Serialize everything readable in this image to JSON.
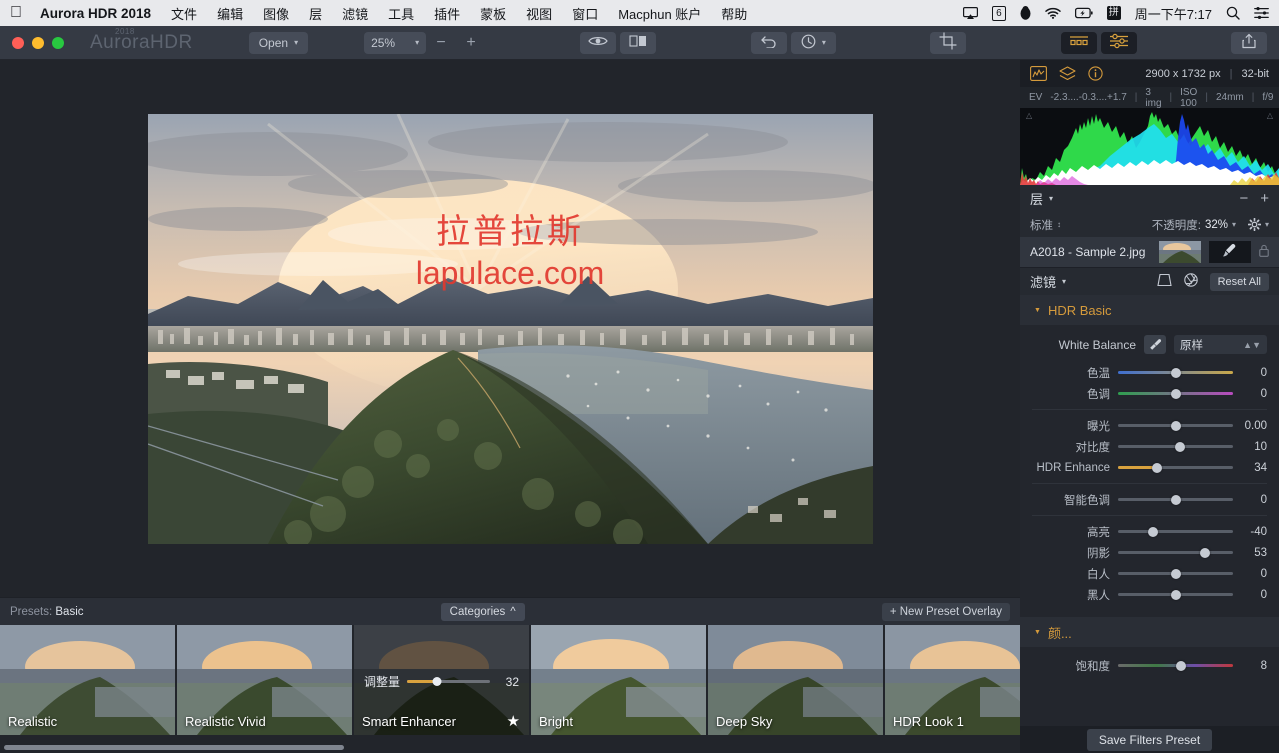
{
  "menubar": {
    "apple": "apple-logo",
    "app_name": "Aurora HDR 2018",
    "items": [
      "文件",
      "编辑",
      "图像",
      "层",
      "滤镜",
      "工具",
      "插件",
      "蒙板",
      "视图",
      "窗口",
      "Macphun 账户",
      "帮助"
    ],
    "status": {
      "airplay": "airplay-icon",
      "badge_count": "6",
      "qq": "qq-icon",
      "wifi": "wifi-icon",
      "battery": "battery-charging-icon",
      "input_method": "拼",
      "clock": "周一下午7:17",
      "search": "search-icon",
      "control_center": "list-icon"
    }
  },
  "toolbar": {
    "logo_text": "AuroraHDR",
    "logo_year": "2018",
    "open_label": "Open",
    "zoom_level": "25%",
    "zoom_out": "−",
    "zoom_in": "+",
    "preview_icon": "eye-icon",
    "compare_icon": "split-compare-icon",
    "undo_icon": "undo-arrow-icon",
    "history_icon": "history-clock-icon",
    "crop_icon": "crop-icon",
    "presets_icon": "presets-grid-icon",
    "filters_icon": "sliders-icon",
    "share_icon": "share-upload-icon"
  },
  "canvas": {
    "watermark_cn": "拉普拉斯",
    "watermark_url": "lapulace.com"
  },
  "presets_bar": {
    "label_prefix": "Presets:",
    "current_category": "Basic",
    "categories_button": "Categories",
    "categories_caret": "^",
    "new_overlay_button": "+ New Preset Overlay"
  },
  "presets": [
    {
      "name": "Realistic",
      "selected": false
    },
    {
      "name": "Realistic Vivid",
      "selected": false
    },
    {
      "name": "Smart Enhancer",
      "selected": true,
      "amount_label": "调整量",
      "amount_value": "32",
      "favorite_icon": "star-icon"
    },
    {
      "name": "Bright",
      "selected": false
    },
    {
      "name": "Deep Sky",
      "selected": false
    },
    {
      "name": "HDR Look 1",
      "selected": false
    }
  ],
  "right_panel": {
    "info": {
      "histogram_icon": "histogram-icon",
      "layers_icon": "layers-icon",
      "info_icon": "info-circle-icon",
      "dimensions": "2900 x 1732 px",
      "bit_depth": "32-bit"
    },
    "exif": {
      "ev_label": "EV",
      "ev_values": "-2.3....-0.3....+1.7",
      "images": "3 img",
      "iso": "ISO 100",
      "focal": "24mm",
      "aperture": "f/9"
    },
    "layers": {
      "title": "层",
      "remove": "−",
      "add": "+",
      "blend_mode": "标准",
      "opacity_label": "不透明度:",
      "opacity_value": "32%",
      "gear_icon": "gear-icon",
      "layer_name": "A2018 - Sample 2.jpg",
      "mask_icon": "brush-mask-icon",
      "lock_icon": "lock-icon"
    },
    "filters": {
      "title": "滤镜",
      "transform_icon": "transform-icon",
      "aperture_icon": "aperture-icon",
      "reset_all": "Reset All",
      "sections": [
        {
          "title": "HDR Basic",
          "white_balance": {
            "label": "White Balance",
            "eyedropper_icon": "eyedropper-icon",
            "value": "原样"
          },
          "groups": [
            {
              "sliders": [
                {
                  "label": "色温",
                  "value": "0",
                  "pos": 50,
                  "type": "temp"
                },
                {
                  "label": "色调",
                  "value": "0",
                  "pos": 50,
                  "type": "tint"
                }
              ]
            },
            {
              "sliders": [
                {
                  "label": "曝光",
                  "value": "0.00",
                  "pos": 50,
                  "type": "plain"
                },
                {
                  "label": "对比度",
                  "value": "10",
                  "pos": 54,
                  "type": "fill"
                },
                {
                  "label": "HDR Enhance",
                  "value": "34",
                  "pos": 34,
                  "type": "fill"
                }
              ]
            },
            {
              "sliders": [
                {
                  "label": "智能色调",
                  "value": "0",
                  "pos": 50,
                  "type": "plain"
                }
              ]
            },
            {
              "sliders": [
                {
                  "label": "高亮",
                  "value": "-40",
                  "pos": 30,
                  "type": "plain"
                },
                {
                  "label": "阴影",
                  "value": "53",
                  "pos": 76,
                  "type": "plain"
                },
                {
                  "label": "白人",
                  "value": "0",
                  "pos": 50,
                  "type": "plain"
                },
                {
                  "label": "黑人",
                  "value": "0",
                  "pos": 50,
                  "type": "plain"
                }
              ]
            }
          ]
        },
        {
          "title": "颜...",
          "groups": [
            {
              "sliders": [
                {
                  "label": "饱和度",
                  "value": "8",
                  "pos": 55,
                  "type": "sat"
                }
              ]
            }
          ]
        }
      ],
      "save_preset_button": "Save Filters Preset"
    }
  }
}
